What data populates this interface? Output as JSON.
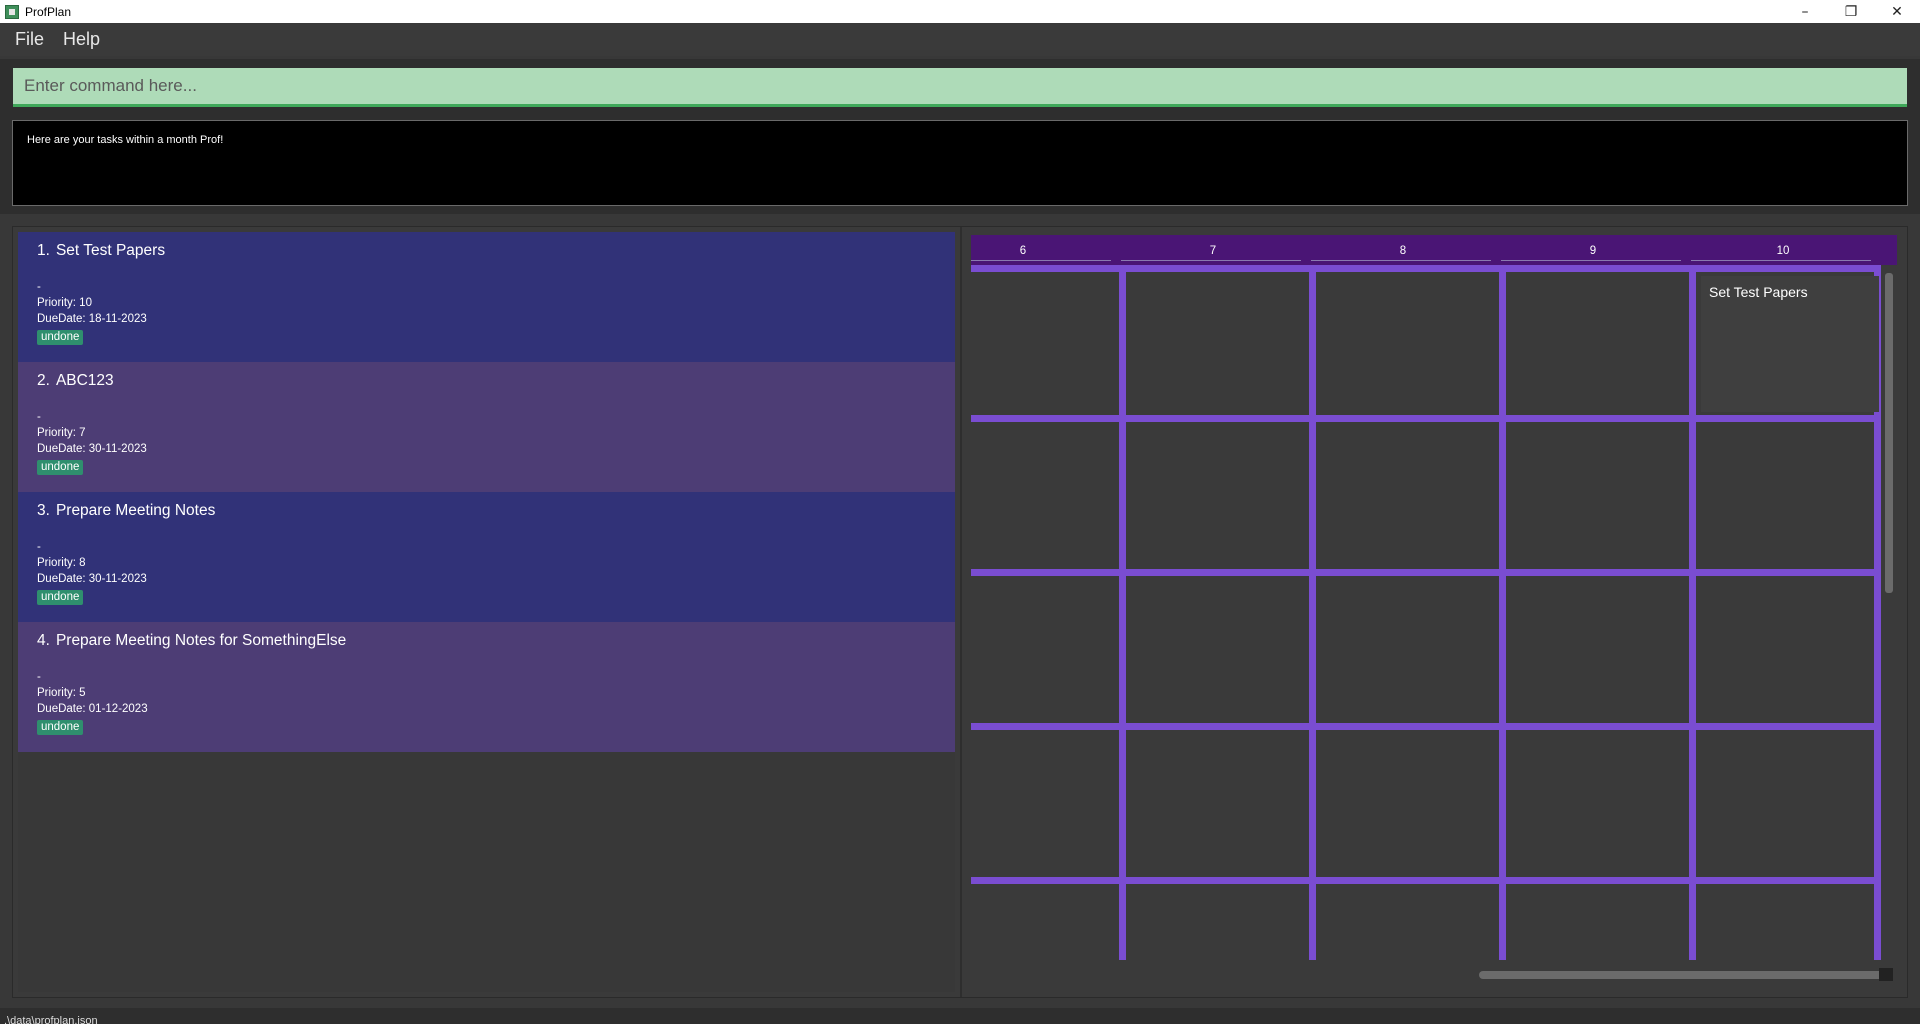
{
  "window": {
    "title": "ProfPlan"
  },
  "menu": {
    "file": "File",
    "help": "Help"
  },
  "command": {
    "placeholder": "Enter command here..."
  },
  "result": {
    "message": "Here are your tasks within a month Prof!"
  },
  "tasks": [
    {
      "index": "1.",
      "name": "Set Test Papers",
      "description": "-",
      "priority": "Priority: 10",
      "due": "DueDate: 18-11-2023",
      "status": "undone"
    },
    {
      "index": "2.",
      "name": "ABC123",
      "description": "-",
      "priority": "Priority: 7",
      "due": "DueDate: 30-11-2023",
      "status": "undone"
    },
    {
      "index": "3.",
      "name": "Prepare Meeting Notes",
      "description": "-",
      "priority": "Priority: 8",
      "due": "DueDate: 30-11-2023",
      "status": "undone"
    },
    {
      "index": "4.",
      "name": "Prepare Meeting Notes for SomethingElse",
      "description": "-",
      "priority": "Priority: 5",
      "due": "DueDate: 01-12-2023",
      "status": "undone"
    }
  ],
  "calendar": {
    "days": [
      "6",
      "7",
      "8",
      "9",
      "10"
    ],
    "events": [
      {
        "day": "10",
        "title": "Set Test Papers"
      }
    ]
  },
  "status": {
    "path": ".\\data\\profplan.json"
  },
  "colors": {
    "task_odd": "#313278",
    "task_even": "#4d3d75",
    "badge": "#2f8f6e",
    "calendar_header": "#4a1575",
    "calendar_grid": "#7a4dd1",
    "command_bg": "#aedbb8"
  }
}
